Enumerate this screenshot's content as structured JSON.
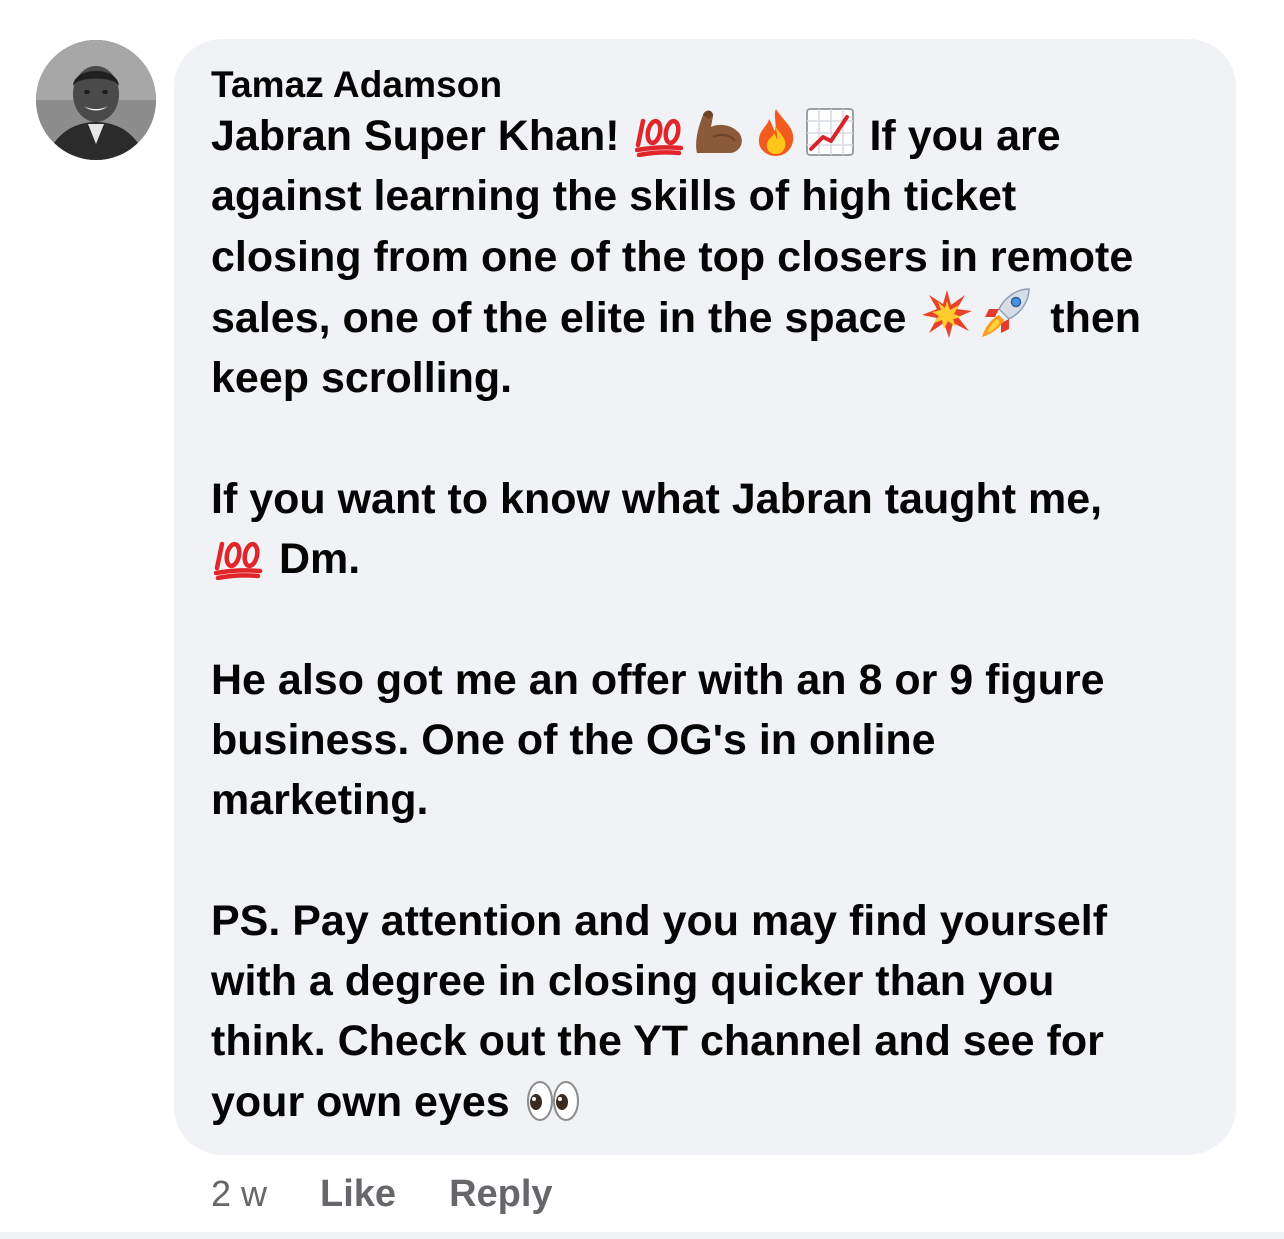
{
  "comment": {
    "author": "Tamaz Adamson",
    "paragraphs": [
      [
        "Jabran Super Khan! ",
        {
          "icon": "hundred-points-icon"
        },
        {
          "icon": "flexed-biceps-icon"
        },
        {
          "icon": "fire-icon"
        },
        {
          "icon": "chart-increasing-icon"
        },
        " If you are",
        "\n",
        "against learning the skills of high ticket",
        "\n",
        "closing from one of the top closers in remote",
        "\n",
        "sales, one of the elite in the space ",
        {
          "icon": "collision-icon"
        },
        {
          "icon": "rocket-icon"
        },
        " then",
        "\n",
        "keep scrolling."
      ],
      [
        "If you want to know what Jabran taught me,",
        "\n",
        {
          "icon": "hundred-points-icon"
        },
        " Dm."
      ],
      [
        "He also got me an offer with an 8 or 9 figure",
        "\n",
        "business. One of the OG's in online",
        "\n",
        "marketing."
      ],
      [
        "PS. Pay attention and you may find yourself",
        "\n",
        "with a degree in closing quicker than you",
        "\n",
        "think. Check out the YT channel and see for",
        "\n",
        "your own eyes ",
        {
          "icon": "eyes-icon"
        }
      ]
    ],
    "timestamp": "2 w",
    "like_label": "Like",
    "reply_label": "Reply"
  },
  "colors": {
    "bubble_bg": "#f0f2f5",
    "text": "#050505",
    "meta": "#65676b"
  }
}
